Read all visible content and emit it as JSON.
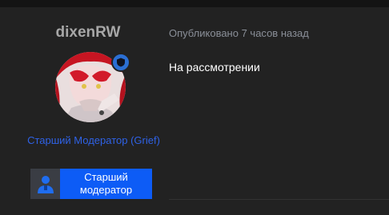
{
  "user": {
    "username": "dixenRW",
    "title": "Старший Модератор (Grief)",
    "banner": "Старший модератор",
    "avatar_icon": "anime-avatar",
    "badge_icon": "shield-icon"
  },
  "post": {
    "meta": "Опубликовано 7 часов назад",
    "body": "На рассмотрении"
  },
  "colors": {
    "accent": "#0d5cf6",
    "title_text": "#2f62e6",
    "background": "#222222"
  }
}
